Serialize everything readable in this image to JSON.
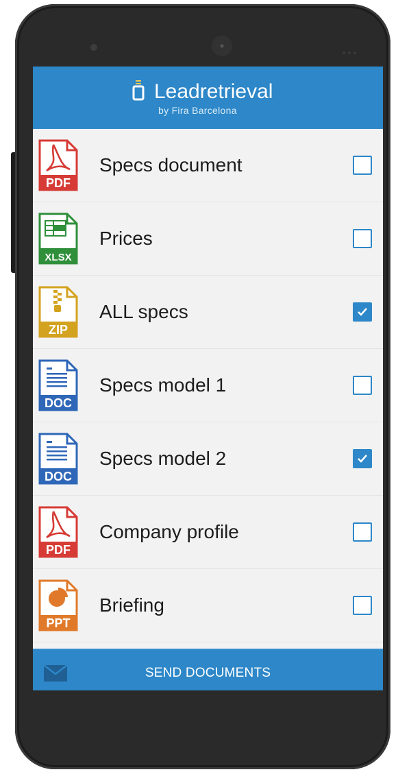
{
  "app": {
    "title": "Leadretrieval",
    "subtitle": "by Fira Barcelona"
  },
  "documents": [
    {
      "label": "Specs document",
      "type": "PDF",
      "icon": "pdf-file-icon",
      "color": "#d63b35",
      "checked": false
    },
    {
      "label": "Prices",
      "type": "XLSX",
      "icon": "xlsx-file-icon",
      "color": "#2f8f3a",
      "checked": false
    },
    {
      "label": "ALL specs",
      "type": "ZIP",
      "icon": "zip-file-icon",
      "color": "#d3a21f",
      "checked": true
    },
    {
      "label": "Specs model 1",
      "type": "DOC",
      "icon": "doc-file-icon",
      "color": "#2f67b8",
      "checked": false
    },
    {
      "label": "Specs model 2",
      "type": "DOC",
      "icon": "doc-file-icon",
      "color": "#2f67b8",
      "checked": true
    },
    {
      "label": "Company profile",
      "type": "PDF",
      "icon": "pdf-file-icon",
      "color": "#d63b35",
      "checked": false
    },
    {
      "label": "Briefing",
      "type": "PPT",
      "icon": "ppt-file-icon",
      "color": "#e07a2a",
      "checked": false
    }
  ],
  "footer": {
    "send_label": "SEND DOCUMENTS",
    "icon": "mail-icon"
  },
  "colors": {
    "accent": "#2d87c8",
    "background": "#f2f2f2"
  }
}
